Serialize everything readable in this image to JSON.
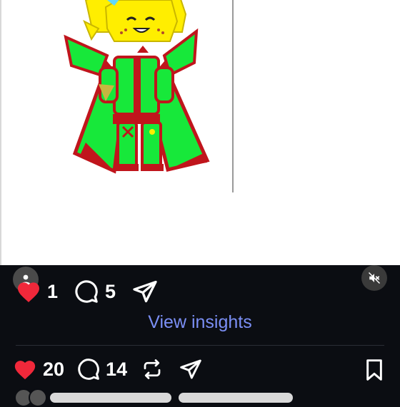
{
  "image": {
    "alt": "",
    "colors": {
      "outline": "#c0151c",
      "green": "#17e83a",
      "yellow": "#ffee00",
      "white": "#ffffff"
    }
  },
  "story": {
    "likes": "1",
    "replies": "5",
    "insights_link": "View insights"
  },
  "post": {
    "likes": "20",
    "comments": "14"
  },
  "icons": {
    "avatar": "person-icon",
    "mute": "speaker-muted-icon",
    "like": "heart-icon",
    "reply": "comment-bubble-icon",
    "share": "send-icon",
    "repost": "repost-icon",
    "save": "bookmark-icon"
  },
  "colors": {
    "heart": "#f0283a",
    "link": "#7b8ff5",
    "background": "#0b0d12",
    "text": "#ffffff"
  }
}
